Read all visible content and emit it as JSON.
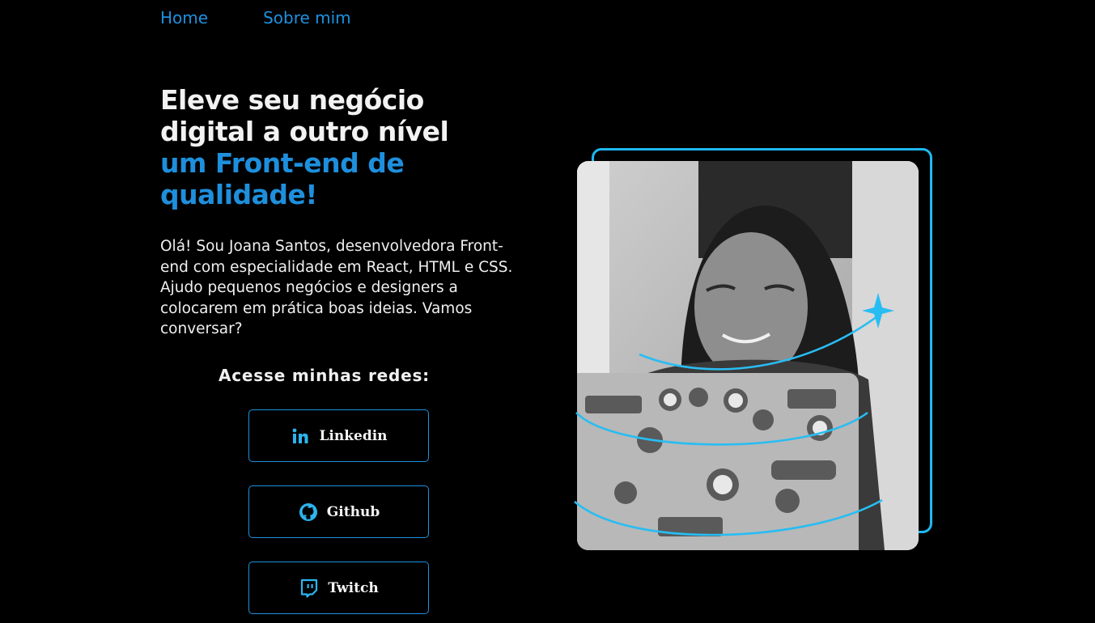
{
  "nav": {
    "home": "Home",
    "about": "Sobre mim"
  },
  "hero": {
    "title_line1": "Eleve seu negócio",
    "title_line2": "digital a outro nível",
    "title_accent1": "um Front-end de",
    "title_accent2": "qualidade!",
    "intro": "Olá! Sou Joana Santos, desenvolvedora Front-end com especialidade em React, HTML e CSS. Ajudo pequenos negócios e designers a colocarem em prática boas ideias. Vamos conversar?"
  },
  "social": {
    "title": "Acesse minhas redes:",
    "buttons": [
      {
        "label": "Linkedin",
        "icon": "linkedin-icon"
      },
      {
        "label": "Github",
        "icon": "github-icon"
      },
      {
        "label": "Twitch",
        "icon": "twitch-icon"
      }
    ]
  },
  "colors": {
    "background": "#000000",
    "accent": "#1e90e0",
    "frame": "#1fb8f0",
    "text": "#f2f2f2"
  }
}
